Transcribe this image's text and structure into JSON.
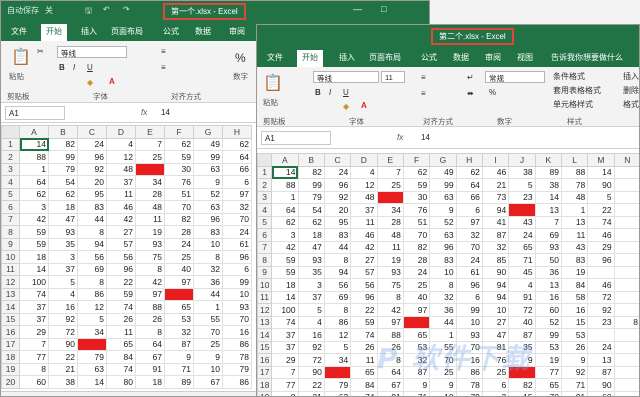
{
  "colors": {
    "excel_green": "#217346",
    "highlight_red": "#e81e1e",
    "title_box": "#e0463a"
  },
  "win1": {
    "autosave": "自动保存",
    "autosave_state": "关",
    "title": "第一个.xlsx - Excel",
    "tabs": [
      "文件",
      "开始",
      "插入",
      "页面布局",
      "公式",
      "数据",
      "审阅"
    ],
    "active_tab": "开始",
    "font_name": "等线",
    "paste": "粘贴",
    "clipboard": "剪贴板",
    "font_group": "字体",
    "align_group": "对齐方式",
    "number": "数字",
    "name_box": "A1",
    "formula": "14",
    "columns": [
      "A",
      "B",
      "C",
      "D",
      "E",
      "F",
      "G",
      "H"
    ],
    "rows": [
      [
        "14",
        "82",
        "24",
        "4",
        "7",
        "62",
        "49",
        "62"
      ],
      [
        "88",
        "99",
        "96",
        "12",
        "25",
        "59",
        "99",
        "64"
      ],
      [
        "1",
        "79",
        "92",
        "48",
        "",
        "30",
        "63",
        "66"
      ],
      [
        "64",
        "54",
        "20",
        "37",
        "34",
        "76",
        "9",
        "6"
      ],
      [
        "62",
        "62",
        "95",
        "11",
        "28",
        "51",
        "52",
        "97"
      ],
      [
        "3",
        "18",
        "83",
        "46",
        "48",
        "70",
        "63",
        "32"
      ],
      [
        "42",
        "47",
        "44",
        "42",
        "11",
        "82",
        "96",
        "70"
      ],
      [
        "59",
        "93",
        "8",
        "27",
        "19",
        "28",
        "83",
        "24"
      ],
      [
        "59",
        "35",
        "94",
        "57",
        "93",
        "24",
        "10",
        "61"
      ],
      [
        "18",
        "3",
        "56",
        "56",
        "75",
        "25",
        "8",
        "96"
      ],
      [
        "14",
        "37",
        "69",
        "96",
        "8",
        "40",
        "32",
        "6"
      ],
      [
        "100",
        "5",
        "8",
        "22",
        "42",
        "97",
        "36",
        "99"
      ],
      [
        "74",
        "4",
        "86",
        "59",
        "97",
        "",
        "44",
        "10"
      ],
      [
        "37",
        "16",
        "12",
        "74",
        "88",
        "65",
        "1",
        "93"
      ],
      [
        "37",
        "92",
        "5",
        "26",
        "26",
        "53",
        "55",
        "70"
      ],
      [
        "29",
        "72",
        "34",
        "11",
        "8",
        "32",
        "70",
        "16"
      ],
      [
        "7",
        "90",
        "",
        "65",
        "64",
        "87",
        "25",
        "86"
      ],
      [
        "77",
        "22",
        "79",
        "84",
        "67",
        "9",
        "9",
        "78"
      ],
      [
        "8",
        "21",
        "63",
        "74",
        "91",
        "71",
        "10",
        "79"
      ],
      [
        "60",
        "38",
        "14",
        "80",
        "18",
        "89",
        "67",
        "86"
      ]
    ],
    "red_cells": [
      [
        2,
        4
      ],
      [
        12,
        5
      ],
      [
        16,
        2
      ]
    ]
  },
  "win2": {
    "title": "第二个.xlsx - Excel",
    "tabs": [
      "文件",
      "开始",
      "插入",
      "页面布局",
      "公式",
      "数据",
      "审阅",
      "视图"
    ],
    "active_tab": "开始",
    "tell_me": "告诉我你想要做什么",
    "font_name": "等线",
    "font_size": "11",
    "number_format": "常规",
    "paste": "粘贴",
    "clipboard": "剪贴板",
    "font_group": "字体",
    "align_group": "对齐方式",
    "number_group": "数字",
    "styles_group": "样式",
    "cond_format": "条件格式",
    "table_format": "套用表格格式",
    "cell_styles": "单元格样式",
    "insert": "插入",
    "delete": "删除",
    "format": "格式",
    "name_box": "A1",
    "formula": "14",
    "columns": [
      "A",
      "B",
      "C",
      "D",
      "E",
      "F",
      "G",
      "H",
      "I",
      "J",
      "K",
      "L",
      "M",
      "N"
    ],
    "rows": [
      [
        "14",
        "82",
        "24",
        "4",
        "7",
        "62",
        "49",
        "62",
        "46",
        "38",
        "89",
        "88",
        "14",
        ""
      ],
      [
        "88",
        "99",
        "96",
        "12",
        "25",
        "59",
        "99",
        "64",
        "21",
        "5",
        "38",
        "78",
        "90",
        ""
      ],
      [
        "1",
        "79",
        "92",
        "48",
        "",
        "30",
        "63",
        "66",
        "73",
        "23",
        "14",
        "48",
        "5",
        ""
      ],
      [
        "64",
        "54",
        "20",
        "37",
        "34",
        "76",
        "9",
        "6",
        "94",
        "",
        "13",
        "1",
        "22",
        ""
      ],
      [
        "62",
        "62",
        "95",
        "11",
        "28",
        "51",
        "52",
        "97",
        "41",
        "43",
        "7",
        "13",
        "74",
        ""
      ],
      [
        "3",
        "18",
        "83",
        "46",
        "48",
        "70",
        "63",
        "32",
        "87",
        "24",
        "69",
        "11",
        "46",
        ""
      ],
      [
        "42",
        "47",
        "44",
        "42",
        "11",
        "82",
        "96",
        "70",
        "32",
        "65",
        "93",
        "43",
        "29",
        ""
      ],
      [
        "59",
        "93",
        "8",
        "27",
        "19",
        "28",
        "83",
        "24",
        "85",
        "71",
        "50",
        "83",
        "96",
        ""
      ],
      [
        "59",
        "35",
        "94",
        "57",
        "93",
        "24",
        "10",
        "61",
        "90",
        "45",
        "36",
        "19",
        "",
        ""
      ],
      [
        "18",
        "3",
        "56",
        "56",
        "75",
        "25",
        "8",
        "96",
        "94",
        "4",
        "13",
        "84",
        "46",
        ""
      ],
      [
        "14",
        "37",
        "69",
        "96",
        "8",
        "40",
        "32",
        "6",
        "94",
        "91",
        "16",
        "58",
        "72",
        ""
      ],
      [
        "100",
        "5",
        "8",
        "22",
        "42",
        "97",
        "36",
        "99",
        "10",
        "72",
        "60",
        "16",
        "92",
        ""
      ],
      [
        "74",
        "4",
        "86",
        "59",
        "97",
        "",
        "44",
        "10",
        "27",
        "40",
        "52",
        "15",
        "23",
        "8"
      ],
      [
        "37",
        "16",
        "12",
        "74",
        "88",
        "65",
        "1",
        "93",
        "47",
        "87",
        "99",
        "53",
        "",
        ""
      ],
      [
        "37",
        "92",
        "5",
        "26",
        "26",
        "53",
        "55",
        "70",
        "81",
        "35",
        "53",
        "26",
        "24",
        ""
      ],
      [
        "29",
        "72",
        "34",
        "11",
        "8",
        "32",
        "70",
        "16",
        "76",
        "9",
        "19",
        "9",
        "13",
        ""
      ],
      [
        "7",
        "90",
        "",
        "65",
        "64",
        "87",
        "25",
        "86",
        "25",
        "",
        "77",
        "92",
        "87",
        ""
      ],
      [
        "77",
        "22",
        "79",
        "84",
        "67",
        "9",
        "9",
        "78",
        "6",
        "82",
        "65",
        "71",
        "90",
        ""
      ],
      [
        "8",
        "21",
        "63",
        "74",
        "91",
        "71",
        "10",
        "79",
        "3",
        "15",
        "70",
        "91",
        "60",
        ""
      ]
    ],
    "red_cells": [
      [
        2,
        4
      ],
      [
        3,
        9
      ],
      [
        12,
        5
      ],
      [
        16,
        2
      ],
      [
        16,
        9
      ]
    ]
  },
  "watermark": "P 软件下载"
}
